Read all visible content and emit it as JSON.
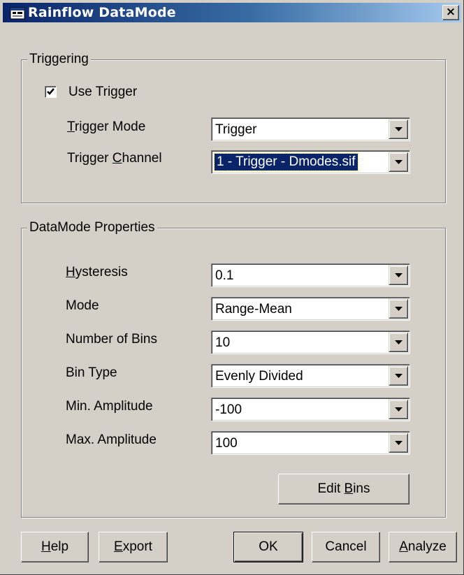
{
  "window": {
    "title": "Rainflow DataMode",
    "icon": "dialog-app-icon",
    "close_label": "×"
  },
  "triggering": {
    "group_label": "Triggering",
    "use_trigger": {
      "label": "Use Trigger",
      "checked": true
    },
    "trigger_mode": {
      "label_pre": "",
      "label_key": "T",
      "label_post": "rigger Mode",
      "value": "Trigger"
    },
    "trigger_channel": {
      "label_pre": "Trigger ",
      "label_key": "C",
      "label_post": "hannel",
      "value": "1 - Trigger - Dmodes.sif"
    }
  },
  "properties": {
    "group_label": "DataMode Properties",
    "hysteresis": {
      "label_pre": "",
      "label_key": "H",
      "label_post": "ysteresis",
      "value": "0.1"
    },
    "mode": {
      "label": "Mode",
      "value": "Range-Mean"
    },
    "number_of_bins": {
      "label": "Number of Bins",
      "value": "10"
    },
    "bin_type": {
      "label": "Bin Type",
      "value": "Evenly Divided"
    },
    "min_amplitude": {
      "label": "Min. Amplitude",
      "value": "-100"
    },
    "max_amplitude": {
      "label": "Max. Amplitude",
      "value": "100"
    },
    "edit_bins": {
      "label_pre": "Edit ",
      "label_key": "B",
      "label_post": "ins"
    }
  },
  "buttons": {
    "help": {
      "label_pre": "",
      "label_key": "H",
      "label_post": "elp"
    },
    "export": {
      "label_pre": "",
      "label_key": "E",
      "label_post": "xport"
    },
    "ok": {
      "label": "OK"
    },
    "cancel": {
      "label": "Cancel"
    },
    "analyze": {
      "label_pre": "",
      "label_key": "A",
      "label_post": "nalyze"
    }
  },
  "colors": {
    "face": "#d4d0c8",
    "title_start": "#0a246a",
    "title_end": "#a6caf0",
    "selection": "#0a246a"
  }
}
